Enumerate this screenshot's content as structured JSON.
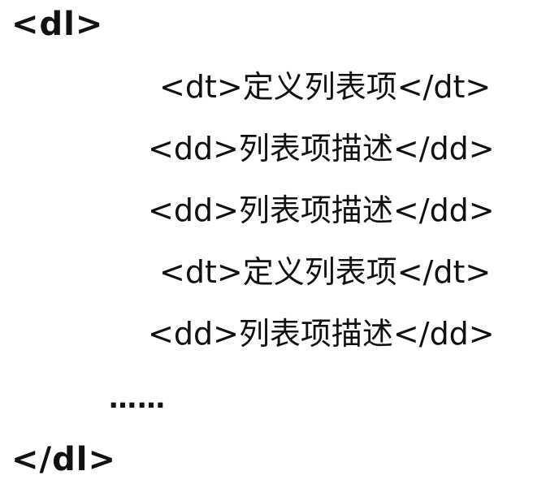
{
  "lines": {
    "open_dl": "<dl>",
    "dt1": "<dt>定义列表项</dt>",
    "dd1": "<dd>列表项描述</dd>",
    "dd2": "<dd>列表项描述</dd>",
    "dt2": "<dt>定义列表项</dt>",
    "dd3": "<dd>列表项描述</dd>",
    "ellipsis": "……",
    "close_dl": "</dl>"
  }
}
